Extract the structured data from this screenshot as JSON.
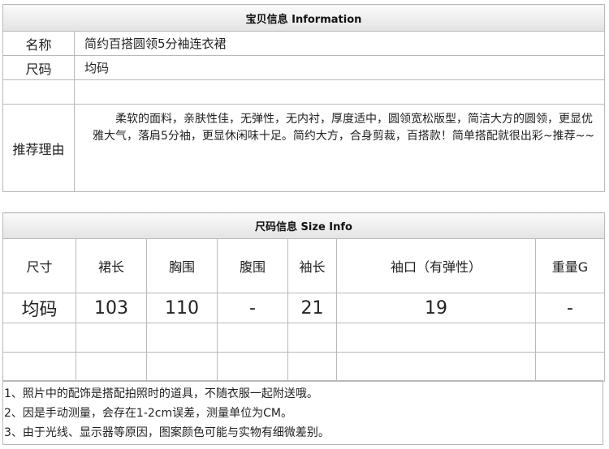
{
  "info": {
    "title": "宝贝信息 Information",
    "rows": [
      {
        "label": "名称",
        "value": "简约百搭圆领5分袖连衣裙"
      },
      {
        "label": "尺码",
        "value": "均码"
      }
    ],
    "reason_label": "推荐理由",
    "reason_text": "柔软的面料，亲肤性佳，无弹性，无内衬，厚度适中，圆领宽松版型，简洁大方的圆领，更显优雅大气，落肩5分袖，更显休闲味十足。简约大方，合身剪裁，百搭款！简单搭配就很出彩~推荐~~"
  },
  "size": {
    "title": "尺码信息 Size Info",
    "headers": [
      "尺寸",
      "裙长",
      "胸围",
      "腹围",
      "袖长",
      "袖口（有弹性）",
      "重量G"
    ],
    "values": [
      "均码",
      "103",
      "110",
      "-",
      "21",
      "19",
      "-"
    ]
  },
  "notes": [
    "1、照片中的配饰是搭配拍照时的道具，不随衣服一起附送哦。",
    "2、因是手动测量，会存在1-2cm误差，测量单位为CM。",
    "3、由于光线、显示器等原因，图案颜色可能与实物有细微差别。"
  ]
}
